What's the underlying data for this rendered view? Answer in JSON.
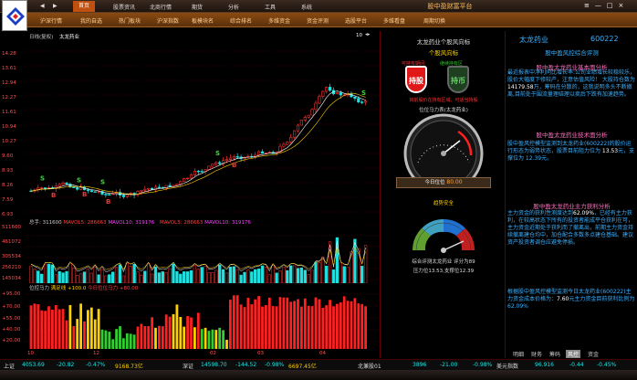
{
  "app": {
    "title": "股中盈财富平台"
  },
  "top_nav": [
    "首页",
    "股票资讯",
    "北商行情",
    "期货",
    "分析",
    "工具",
    "系统"
  ],
  "top_nav_active": 0,
  "sub_nav": [
    "沪深行情",
    "我的自选",
    "热门板块",
    "沪深指数",
    "板模块名",
    "综合排名",
    "多维资金",
    "资金评测",
    "选股平台",
    "多维看盘",
    "周期切换"
  ],
  "chart_header": {
    "period": "日线(复权)",
    "stock_name": "太龙药业",
    "zoom": "10"
  },
  "candle_chart": {
    "type": "candlestick",
    "y_ticks": [
      "14.28",
      "13.61",
      "12.94",
      "12.27",
      "11.61",
      "10.94",
      "10.27",
      "9.60",
      "8.93",
      "8.26",
      "7.59",
      "6.93"
    ],
    "signal_buy_label": "B",
    "signal_sell_label": "S"
  },
  "volume_chart": {
    "type": "bar",
    "legend_total_label": "总手:",
    "legend_total_value": "311600",
    "legend_ma5_label": "MAVOL5:",
    "legend_ma5_value": "286663",
    "legend_ma10_label": "MAVOL10:",
    "legend_ma10_value": "319176",
    "legend2_ma5_value": "286663",
    "legend2_ma10_value": "319176",
    "y_ticks": [
      "511600",
      "461072",
      "305534",
      "256210",
      "145034"
    ]
  },
  "power_chart": {
    "type": "bar",
    "legend_title": "位控马力",
    "legend_line_label": "满足线",
    "legend_line_value": "+100.0",
    "legend_today_label": "今日位位马力",
    "legend_today_value": "+80.00",
    "y_ticks": [
      "+95.00",
      "+70.00",
      "+55.00",
      "+40.00",
      "+20.00"
    ]
  },
  "x_axis": [
    "10",
    "12",
    "02",
    "03",
    "04"
  ],
  "mid_panel": {
    "title": "太龙药业个股风向标",
    "section_title": "个股风向标",
    "hold_label": "可持有期间",
    "sell_label": "继续持有区",
    "hold_button": "持股",
    "sell_button": "持币",
    "hold_note": "目前股价在持有区域，可适当持股",
    "gauge1_title": "位位马力表(太龙药业)",
    "gauge1_label": "今日位位",
    "gauge1_value": "80.00",
    "gauge2_title": "趋势安全",
    "gauge2_caption1": "综合评测太龙药业 评分为89",
    "gauge2_caption2": "压力位13.53,支撑位12.39"
  },
  "stock_info": {
    "name": "太龙药业",
    "code": "600222"
  },
  "right_panel": {
    "top_title": "股中盈风控综合评测",
    "sections": [
      {
        "title": "股中盈太龙药业基本面分析",
        "text": "最近报表中净利同比增长率:公司业绩增长较稳较乐，股价大幅度下修较产，注意估值风险！  大股持仓数为 ",
        "highlight": "14179.58",
        "tail": "万，筹码在分散的，这就说明多头不断撤离,目前处于围流量理结理以卖后下跌有加速趋势。"
      },
      {
        "title": "股中盈太龙药业技术面分析",
        "text": "股中盈风控模型监测到太龙药业(600222)的股价运行形态为弱势状态，股票目前阻力位为 ",
        "highlight": "13.53",
        "tail": "元，支撑位为 12.39元。"
      },
      {
        "title": "股中盈太龙药业主力获利分析",
        "text": "主力资金的获利性测度达到",
        "highlight": "62.09%",
        "tail": "，已经有主力获利，在较高状态下所有的投资者能成平仓获利在可，主力资金近期处于获利而了撤离出，前期主力资金持续撤离建仓均中，加仓配合多数多点建仓基础。建议资产投资者调仓应避免停损。"
      },
      {
        "title": "",
        "text": "根据股中盈风控模型监测今日太龙药业(600222)主力资金成本价格为：",
        "highlight": "7.60",
        "tail": "元主力资金目前获利比例为62.09%"
      }
    ]
  },
  "bottom_tabs": [
    "明细",
    "财务",
    "筹码",
    "风控",
    "资金"
  ],
  "bottom_tabs_active": 3,
  "status_bar": [
    {
      "label": "上证",
      "value": "4053.69",
      "change": "-20.82",
      "pct": "-0.47%",
      "amount": "9168.73亿"
    },
    {
      "label": "深证",
      "value": "14598.70",
      "change": "-144.52",
      "pct": "-0.98%",
      "amount": "6697.45亿"
    },
    {
      "label": "北兼股01",
      "value": "3896",
      "change": "-21.00",
      "pct": "-0.98%",
      "amount": "美元指数"
    },
    {
      "label": "",
      "value": "96.916",
      "change": "-0.44",
      "pct": "-0.45%",
      "amount": ""
    }
  ],
  "colors": {
    "up": "#ff3030",
    "down": "#20e0e0",
    "accent": "#c05010",
    "panel_text": "#3ab0ff",
    "panel_head": "#ff70c0"
  }
}
